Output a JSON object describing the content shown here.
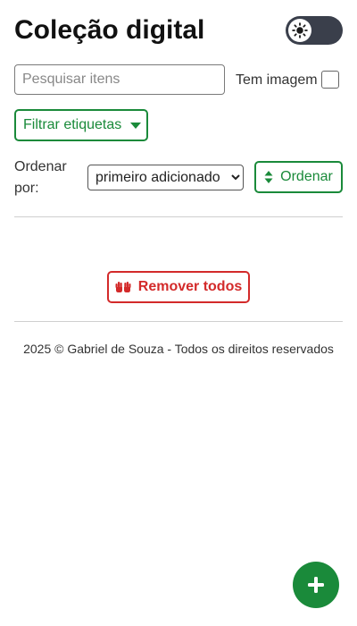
{
  "header": {
    "title": "Coleção digital",
    "theme_toggle_icon": "sun-icon"
  },
  "filters": {
    "search_placeholder": "Pesquisar itens",
    "search_value": "",
    "has_image_label": "Tem imagem",
    "has_image_checked": false,
    "filter_tags_label": "Filtrar etiquetas",
    "filter_tags_icon": "caret-down-icon"
  },
  "sort": {
    "label": "Ordenar por:",
    "selected": "primeiro adicionado",
    "button_label": "Ordenar",
    "button_icon": "sort-icon"
  },
  "actions": {
    "remove_all_label": "Remover todos",
    "remove_all_icon": "hands-icon",
    "add_icon": "plus-icon"
  },
  "footer": {
    "text": "2025 © Gabriel de Souza - Todos os direitos reservados"
  },
  "colors": {
    "accent_green": "#1a8a3a",
    "danger_red": "#d32a2a",
    "toggle_dark": "#3a3f4b"
  }
}
